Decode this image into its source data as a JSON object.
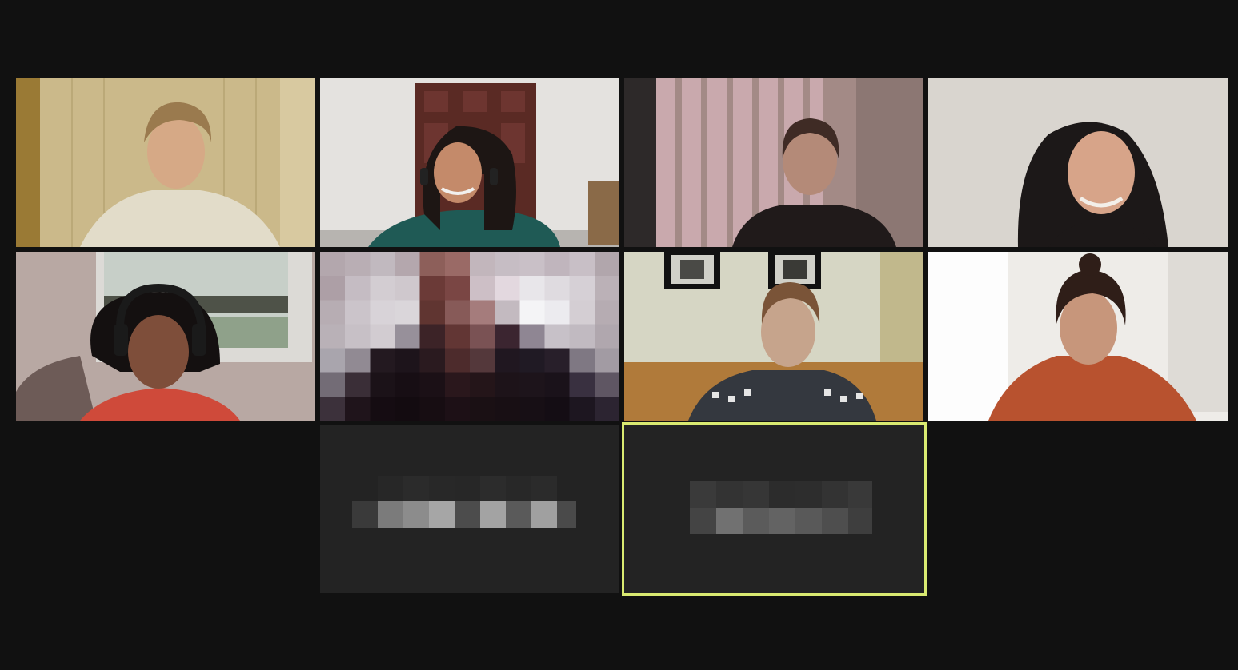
{
  "meeting": {
    "view": "gallery",
    "participant_count": 10,
    "active_speaker_index": 9,
    "colors": {
      "background": "#111111",
      "active_border": "#d9ea71",
      "name_tile": "#232323"
    }
  },
  "participants": [
    {
      "video": "on"
    },
    {
      "video": "on"
    },
    {
      "video": "on"
    },
    {
      "video": "on"
    },
    {
      "video": "on"
    },
    {
      "video": "pixelated"
    },
    {
      "video": "on"
    },
    {
      "video": "on"
    },
    {
      "video": "off",
      "name_pixelated": true
    },
    {
      "video": "off",
      "name_pixelated": true,
      "active_speaker": true
    }
  ]
}
